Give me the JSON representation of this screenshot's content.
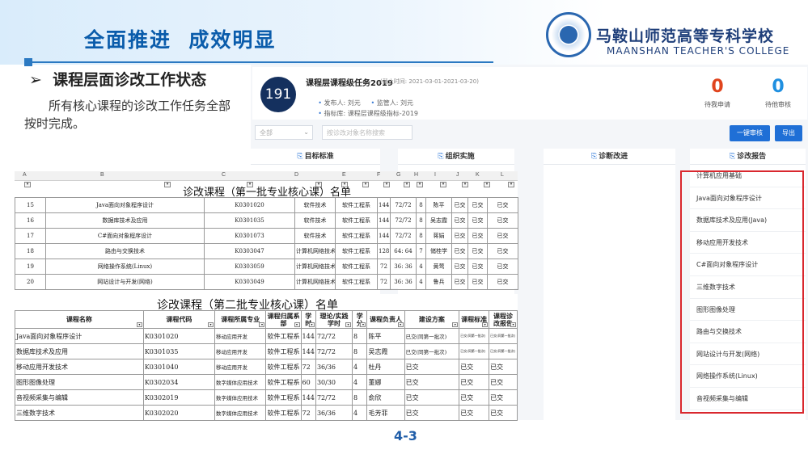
{
  "slide": {
    "title": "全面推进  成效明显",
    "school_name_cn": "马鞍山师范高等专科学校",
    "school_name_en": "MAANSHAN TEACHER'S COLLEGE",
    "section_heading": "➢  课程层面诊改工作状态",
    "body_text": "所有核心课程的诊改工作任务全部按时完成。",
    "page_number": "4-3"
  },
  "app": {
    "task": {
      "badge": "191",
      "title": "课程层课程级任务2019",
      "deadline": "(截止时间: 2021-03-01-2021-03-20)",
      "publisher_label": "发布人: ",
      "publisher": "刘元",
      "supervisor_label": "监管人: ",
      "supervisor": "刘元",
      "indicator_label": "指标库: ",
      "indicator": "课程层课程级指标-2019"
    },
    "stats": [
      {
        "value": "0",
        "label": "待我申请",
        "color": "#e0441d"
      },
      {
        "value": "0",
        "label": "待他审核",
        "color": "#1f8fe0"
      }
    ],
    "filter": {
      "selected": "全部",
      "search_placeholder": "按诊改对象名称搜索"
    },
    "buttons": {
      "batch_review": "一键审核",
      "export": "导出"
    },
    "panels": {
      "goal": "目标标准",
      "organize": "组织实施",
      "diagnose": "诊断改进",
      "report": "诊改报告"
    },
    "report_items": [
      "计算机应用基础",
      "Java面向对象程序设计",
      "数据库技术及应用(Java)",
      "移动应用开发技术",
      "C#面向对象程序设计",
      "三维数字技术",
      "图形图像处理",
      "路由与交换技术",
      "网站设计与开发(网络)",
      "网络操作系统(Linux)",
      "音视频采集与编辑"
    ]
  },
  "sheet1": {
    "title": "诊改课程（第一批专业核心课）名单",
    "col_letters": [
      "A",
      "B",
      "C",
      "D",
      "E",
      "F",
      "G",
      "H",
      "I",
      "J",
      "K",
      "L"
    ],
    "rows": [
      [
        "15",
        "Java面向对象程序设计",
        "K0301020",
        "软件技术",
        "软件工程系",
        "144",
        "72/72",
        "8",
        "陈平",
        "已交",
        "已交",
        "已交"
      ],
      [
        "16",
        "数据库技术及应用",
        "K0301035",
        "软件技术",
        "软件工程系",
        "144",
        "72/72",
        "8",
        "吴志霞",
        "已交",
        "已交",
        "已交"
      ],
      [
        "17",
        "C#面向对象程序设计",
        "K0301073",
        "软件技术",
        "软件工程系",
        "144",
        "72/72",
        "8",
        "蒋娟",
        "已交",
        "已交",
        "已交"
      ],
      [
        "18",
        "路由与交换技术",
        "K0303047",
        "计算机网络技术",
        "软件工程系",
        "128",
        "64: 64",
        "7",
        "储桂学",
        "已交",
        "已交",
        "已交"
      ],
      [
        "19",
        "网络操作系统(Linux)",
        "K0303059",
        "计算机网络技术",
        "软件工程系",
        "72",
        "36: 36",
        "4",
        "黄莺",
        "已交",
        "已交",
        "已交"
      ],
      [
        "20",
        "网站设计与开发(网络)",
        "K0303049",
        "计算机网络技术",
        "软件工程系",
        "72",
        "36: 36",
        "4",
        "鲁兵",
        "已交",
        "已交",
        "已交"
      ]
    ]
  },
  "sheet2": {
    "title": "诊改课程（第二批专业核心课）名单",
    "headers": [
      "课程名称",
      "课程代码",
      "课程所属专业",
      "课程归属系部",
      "学时",
      "理论/实践学时",
      "学分",
      "课程负责人",
      "建设方案",
      "课程标准",
      "课程诊改报告"
    ],
    "rows": [
      [
        "Java面向对象程序设计",
        "K0301020",
        "移动应用开发",
        "软件工程系",
        "144",
        "72/72",
        "8",
        "陈平",
        "已交(同第一批次)",
        "已交(同第一批次)",
        "已交(同第一批次)"
      ],
      [
        "数据库技术及应用",
        "K0301035",
        "移动应用开发",
        "软件工程系",
        "144",
        "72/72",
        "8",
        "吴志霞",
        "已交(同第一批次)",
        "已交(同第一批次)",
        "已交(同第一批次)"
      ],
      [
        "移动应用开发技术",
        "K0301040",
        "移动应用开发",
        "软件工程系",
        "72",
        "36/36",
        "4",
        "杜丹",
        "已交",
        "已交",
        "已交"
      ],
      [
        "图形图像处理",
        "K0302034",
        "数字媒体应用技术",
        "软件工程系",
        "60",
        "30/30",
        "4",
        "董娜",
        "已交",
        "已交",
        "已交"
      ],
      [
        "音视频采集与编辑",
        "K0302019",
        "数字媒体应用技术",
        "软件工程系",
        "144",
        "72/72",
        "8",
        "俞欣",
        "已交",
        "已交",
        "已交"
      ],
      [
        "三维数字技术",
        "K0302020",
        "数字媒体应用技术",
        "软件工程系",
        "72",
        "36/36",
        "4",
        "毛芳菲",
        "已交",
        "已交",
        "已交"
      ]
    ]
  }
}
